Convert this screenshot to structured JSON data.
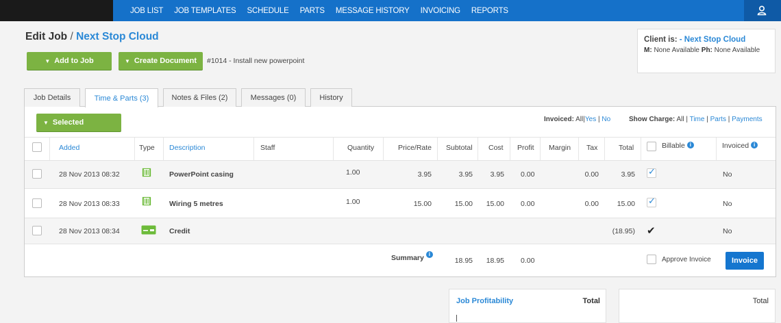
{
  "nav": {
    "items": [
      "JOB LIST",
      "JOB TEMPLATES",
      "SCHEDULE",
      "PARTS",
      "MESSAGE HISTORY",
      "INVOICING",
      "REPORTS"
    ],
    "user_icon": "user-icon"
  },
  "header": {
    "title_prefix": "Edit Job",
    "separator": "/",
    "client_name": "Next Stop Cloud",
    "add_to_job_label": "Add to Job",
    "create_document_label": "Create Document",
    "job_number": "#1014 - Install new powerpoint"
  },
  "client_box": {
    "client_label": "Client is:",
    "client_link": "- Next Stop Cloud",
    "mobile_label": "M:",
    "mobile_value": "None Available",
    "phone_label": "Ph:",
    "phone_value": "None Available"
  },
  "tabs": [
    "Job Details",
    "Time & Parts (3)",
    "Notes & Files (2)",
    "Messages (0)",
    "History"
  ],
  "active_tab": "Time & Parts (3)",
  "toolbar": {
    "selected_label": "Selected",
    "invoiced_label": "Invoiced:",
    "invoiced_all": "All",
    "invoiced_yes": "Yes",
    "invoiced_no": "No",
    "show_charge_label": "Show Charge:",
    "charge_all": "All",
    "charge_time": "Time",
    "charge_parts": "Parts",
    "charge_payments": "Payments",
    "pipe": "|"
  },
  "table": {
    "headers": {
      "added": "Added",
      "type": "Type",
      "description": "Description",
      "staff": "Staff",
      "quantity": "Quantity",
      "price_rate": "Price/Rate",
      "subtotal": "Subtotal",
      "cost": "Cost",
      "profit": "Profit",
      "margin": "Margin",
      "tax": "Tax",
      "total": "Total",
      "billable": "Billable",
      "invoiced": "Invoiced"
    },
    "rows": [
      {
        "added": "28 Nov 2013 08:32",
        "type_icon": "part-icon",
        "description": "PowerPoint casing",
        "quantity": "1.00",
        "price": "3.95",
        "subtotal": "3.95",
        "cost": "3.95",
        "profit": "0.00",
        "tax": "0.00",
        "total": "3.95",
        "billable": "checked",
        "invoiced": "No"
      },
      {
        "added": "28 Nov 2013 08:33",
        "type_icon": "part-icon",
        "description": "Wiring 5 metres",
        "quantity": "1.00",
        "price": "15.00",
        "subtotal": "15.00",
        "cost": "15.00",
        "profit": "0.00",
        "tax": "0.00",
        "total": "15.00",
        "billable": "checked",
        "invoiced": "No"
      },
      {
        "added": "28 Nov 2013 08:34",
        "type_icon": "credit-card-icon",
        "description": "Credit",
        "total": "(18.95)",
        "billable": "tick",
        "invoiced": "No"
      }
    ],
    "summary": {
      "label": "Summary",
      "subtotal": "18.95",
      "cost": "18.95",
      "profit": "0.00",
      "approve_label": "Approve Invoice",
      "invoice_button": "Invoice"
    }
  },
  "bottom": {
    "profitability_title": "Job Profitability",
    "profitability_total": "Total",
    "right_total": "Total"
  },
  "colors": {
    "nav_blue": "#1571c9",
    "accent_green": "#7cb342",
    "link_blue": "#2a88d6",
    "button_blue": "#1576cf"
  }
}
